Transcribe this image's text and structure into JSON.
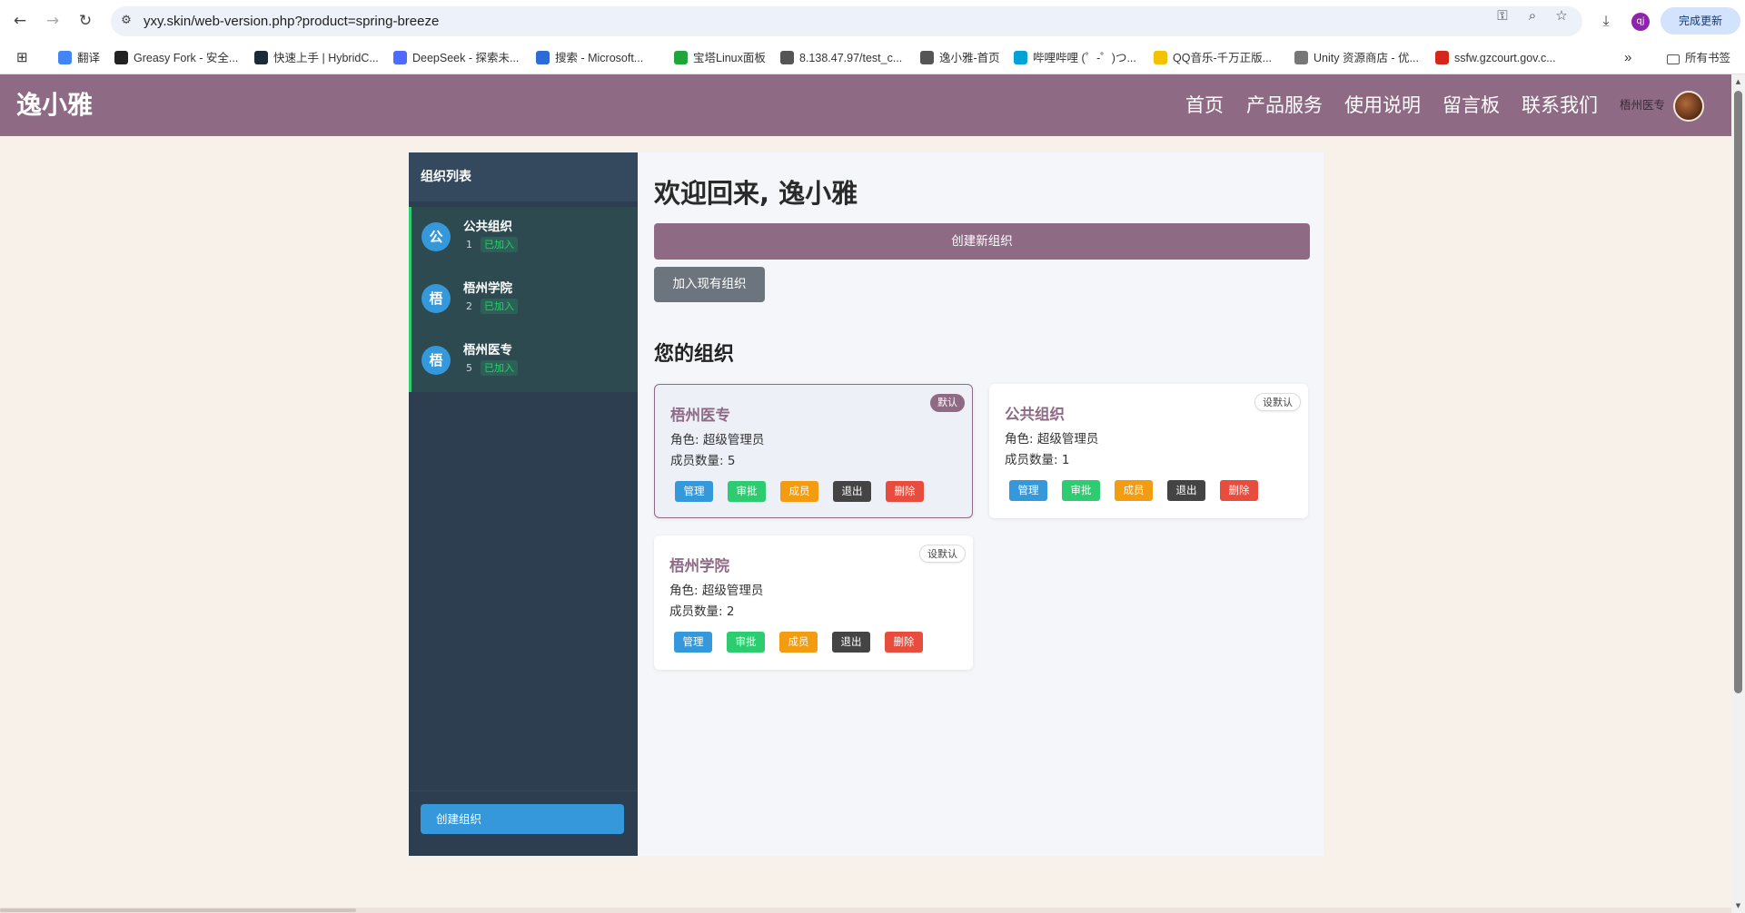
{
  "browser": {
    "url": "yxy.skin/web-version.php?product=spring-breeze",
    "profile_initial": "qj",
    "update_label": "完成更新",
    "bookmarks": [
      {
        "label": "翻译",
        "icon": "translate-icon",
        "color": "#4285f4"
      },
      {
        "label": "Greasy Fork - 安全...",
        "icon": "greasyfork-icon",
        "color": "#222222"
      },
      {
        "label": "快速上手 | HybridC...",
        "icon": "hybridclr-icon",
        "color": "#1b2a3a"
      },
      {
        "label": "DeepSeek - 探索未...",
        "icon": "deepseek-icon",
        "color": "#4d6bfe"
      },
      {
        "label": "搜索 - Microsoft...",
        "icon": "search-icon",
        "color": "#2b6cd9"
      },
      {
        "label": "宝塔Linux面板",
        "icon": "baota-icon",
        "color": "#20a53a"
      },
      {
        "label": "8.138.47.97/test_c...",
        "icon": "globe-icon",
        "color": "#555555"
      },
      {
        "label": "逸小雅-首页",
        "icon": "globe-icon",
        "color": "#555555"
      },
      {
        "label": "哔哩哔哩 (゜-゜)つ...",
        "icon": "bilibili-icon",
        "color": "#00a1d6"
      },
      {
        "label": "QQ音乐-千万正版...",
        "icon": "qqmusic-icon",
        "color": "#f2c100"
      },
      {
        "label": "Unity 资源商店 - 优...",
        "icon": "unity-icon",
        "color": "#777777"
      },
      {
        "label": "ssfw.gzcourt.gov.c...",
        "icon": "court-icon",
        "color": "#d6261c"
      }
    ],
    "all_bookmarks": "所有书签"
  },
  "site": {
    "logo": "逸小雅",
    "nav": [
      "首页",
      "产品服务",
      "使用说明",
      "留言板",
      "联系我们"
    ],
    "user_name": "梧州医专"
  },
  "sidebar": {
    "title": "组织列表",
    "orgs": [
      {
        "initial": "公",
        "name": "公共组织",
        "count": "1",
        "status": "已加入"
      },
      {
        "initial": "梧",
        "name": "梧州学院",
        "count": "2",
        "status": "已加入"
      },
      {
        "initial": "梧",
        "name": "梧州医专",
        "count": "5",
        "status": "已加入"
      }
    ],
    "create_label": "创建组织"
  },
  "main": {
    "welcome": "欢迎回来, 逸小雅",
    "create_org": "创建新组织",
    "join_org": "加入现有组织",
    "section_title": "您的组织",
    "cards": [
      {
        "name": "梧州医专",
        "role": "角色: 超级管理员",
        "members": "成员数量: 5",
        "tag": "默认",
        "is_default": true
      },
      {
        "name": "公共组织",
        "role": "角色: 超级管理员",
        "members": "成员数量: 1",
        "tag": "设默认",
        "is_default": false
      },
      {
        "name": "梧州学院",
        "role": "角色: 超级管理员",
        "members": "成员数量: 2",
        "tag": "设默认",
        "is_default": false
      }
    ],
    "actions": {
      "manage": "管理",
      "approve": "审批",
      "members": "成员",
      "quit": "退出",
      "delete": "删除"
    }
  },
  "colors": {
    "brand": "#8e6a85",
    "sidebar": "#2c3e50",
    "manage": "#3498db",
    "approve": "#2ecc71",
    "members": "#f39c12",
    "quit": "#444444",
    "delete": "#e74c3c"
  }
}
